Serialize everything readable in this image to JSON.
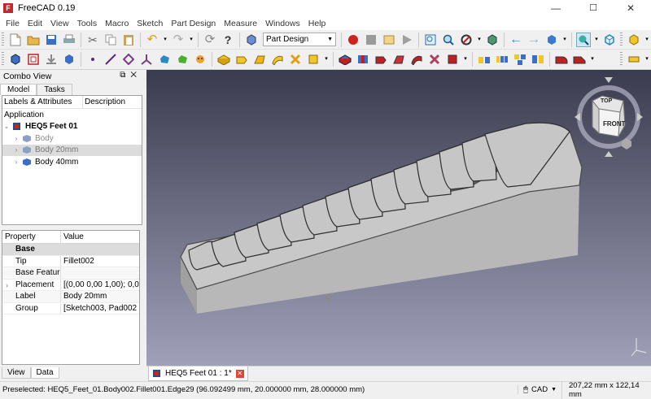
{
  "window": {
    "title": "FreeCAD 0.19",
    "minimize": "—",
    "maximize": "☐",
    "close": "✕"
  },
  "menu": [
    "File",
    "Edit",
    "View",
    "Tools",
    "Macro",
    "Sketch",
    "Part Design",
    "Measure",
    "Windows",
    "Help"
  ],
  "toolbar": {
    "workbench": "Part Design"
  },
  "combo": {
    "title": "Combo View",
    "tab_model": "Model",
    "tab_tasks": "Tasks"
  },
  "tree": {
    "col_labels": "Labels & Attributes",
    "col_desc": "Description",
    "section": "Application",
    "items": [
      {
        "label": "HEQ5 Feet 01"
      },
      {
        "label": "Body"
      },
      {
        "label": "Body 20mm"
      },
      {
        "label": "Body 40mm"
      }
    ]
  },
  "props": {
    "col_property": "Property",
    "col_value": "Value",
    "group": "Base",
    "rows": [
      {
        "name": "Tip",
        "value": "Fillet002"
      },
      {
        "name": "Base Feature",
        "value": ""
      },
      {
        "name": "Placement",
        "value": "[(0,00 0,00 1,00); 0,00 ..."
      },
      {
        "name": "Label",
        "value": "Body 20mm"
      },
      {
        "name": "Group",
        "value": "[Sketch003, Pad002 (..."
      }
    ]
  },
  "bottom_tabs": [
    "View",
    "Data"
  ],
  "navcube": {
    "top": "TOP",
    "front": "FRONT"
  },
  "doc_tab": {
    "label": "HEQ5 Feet 01 : 1*"
  },
  "status": {
    "preselected": "Preselected: HEQ5_Feet_01.Body002.Fillet001.Edge29 (96.092499 mm, 20.000000 mm, 28.000000 mm)",
    "nav": "CAD",
    "dimensions": "207,22 mm x 122,14 mm"
  },
  "colors": {
    "viewport_top": "#3b3b4f",
    "viewport_bottom": "#a0a0b9",
    "model_face": "#c8c8c8",
    "model_side": "#a5a5a5",
    "record": "#d02020",
    "selection": "#dcdcdc"
  }
}
